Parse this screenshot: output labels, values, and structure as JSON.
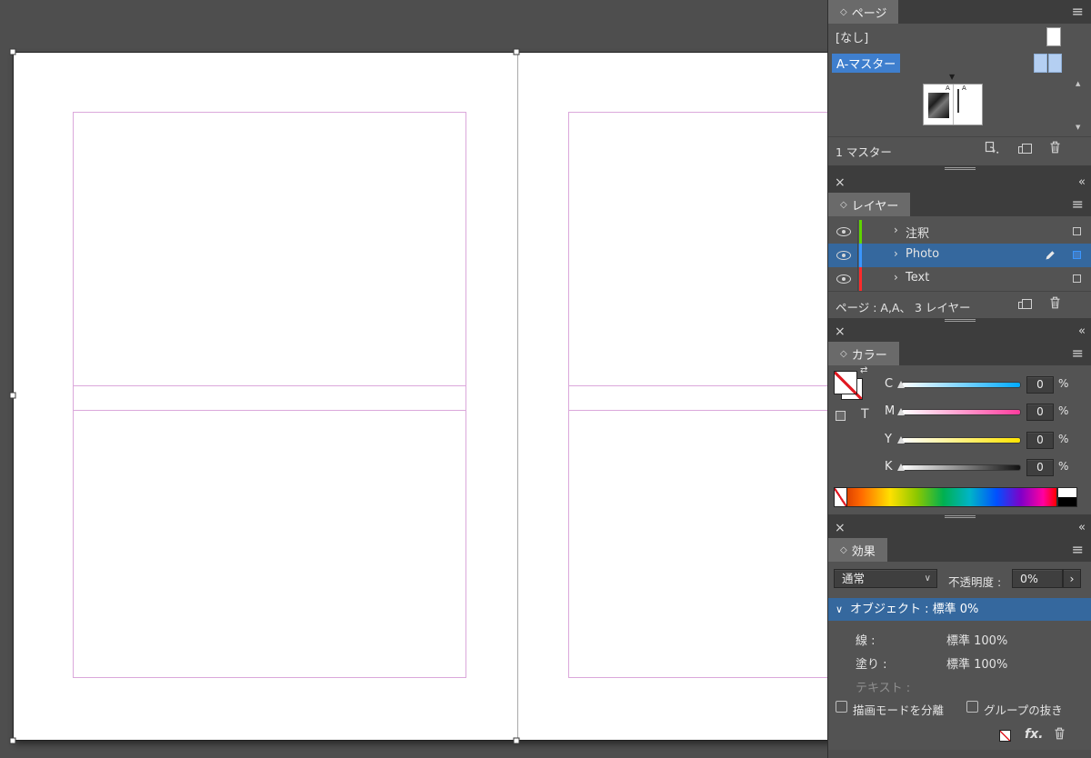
{
  "colors": {
    "selection_blue": "#35689e",
    "highlight_blue": "#3f7fce",
    "guide_pink": "#dba8db",
    "layer_annotation_green": "#5fd400",
    "layer_photo_blue": "#3a96ff",
    "layer_text_red": "#ff2a2a",
    "master_page_blue": "#b4cff2",
    "accent_red": "#e01b24"
  },
  "icons": {
    "menu": "≡",
    "close": "×",
    "collapse": "«",
    "diamond": "◇",
    "disclosure_right": "›",
    "disclosure_down": "∨",
    "dropdown_chevron": "∨",
    "forward_chevron": "›",
    "down_triangle": "▼",
    "up_triangle": "▲",
    "swap_arrows": "⇄"
  },
  "pages_panel": {
    "tab_label": "ページ",
    "none_label": "[なし]",
    "master_label": "A-マスター",
    "thumb_letter_left": "A",
    "thumb_letter_right": "A",
    "footer_label": "1 マスター"
  },
  "layers_panel": {
    "tab_label": "レイヤー",
    "layers": [
      {
        "name": "注釈"
      },
      {
        "name": "Photo"
      },
      {
        "name": "Text"
      }
    ],
    "footer_label": "ページ : A,A、 3 レイヤー"
  },
  "color_panel": {
    "tab_label": "カラー",
    "text_toggle_label": "T",
    "sliders": [
      {
        "channel": "C",
        "value": "0"
      },
      {
        "channel": "M",
        "value": "0"
      },
      {
        "channel": "Y",
        "value": "0"
      },
      {
        "channel": "K",
        "value": "0"
      }
    ],
    "unit": "%"
  },
  "effects_panel": {
    "tab_label": "効果",
    "blend_mode": "通常",
    "opacity_label": "不透明度 :",
    "opacity_value": "0%",
    "object_summary": "オブジェクト : 標準 0%",
    "attributes": [
      {
        "label": "線 :",
        "value": "標準 100%"
      },
      {
        "label": "塗り :",
        "value": "標準 100%"
      },
      {
        "label": "テキスト :",
        "value": ""
      }
    ],
    "isolate_blending_label": "描画モードを分離",
    "knockout_group_label": "グループの抜き",
    "fx_label": "fx."
  }
}
